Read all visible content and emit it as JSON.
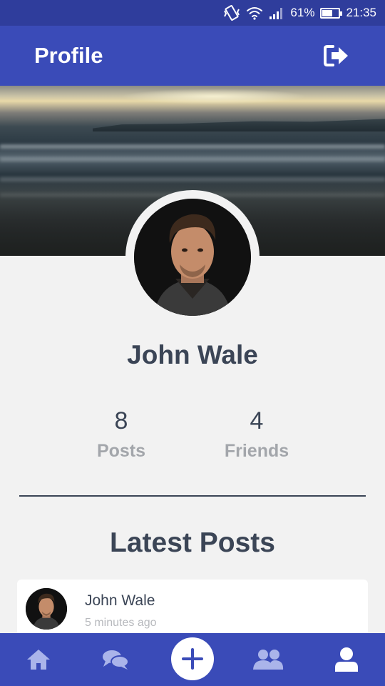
{
  "status_bar": {
    "battery_percent": "61%",
    "battery_level": 0.61,
    "time": "21:35",
    "icons": [
      "vibrate-icon",
      "wifi-icon",
      "signal-icon",
      "battery-icon"
    ]
  },
  "app_bar": {
    "title": "Profile",
    "action_icon": "logout-icon"
  },
  "profile": {
    "name": "John Wale",
    "stats": {
      "posts_count": "8",
      "posts_label": "Posts",
      "friends_count": "4",
      "friends_label": "Friends"
    }
  },
  "latest_posts": {
    "title": "Latest Posts",
    "items": [
      {
        "author": "John Wale",
        "time": "5 minutes ago"
      }
    ]
  },
  "bottom_nav": {
    "items": [
      "home-icon",
      "chat-icon",
      "add-icon",
      "friends-icon",
      "profile-icon"
    ]
  },
  "colors": {
    "primary": "#3a4bb8",
    "status_bar": "#2f3d9c",
    "text_dark": "#3b4556",
    "text_muted": "#a3a6ab",
    "nav_inactive": "#aab4ea"
  }
}
